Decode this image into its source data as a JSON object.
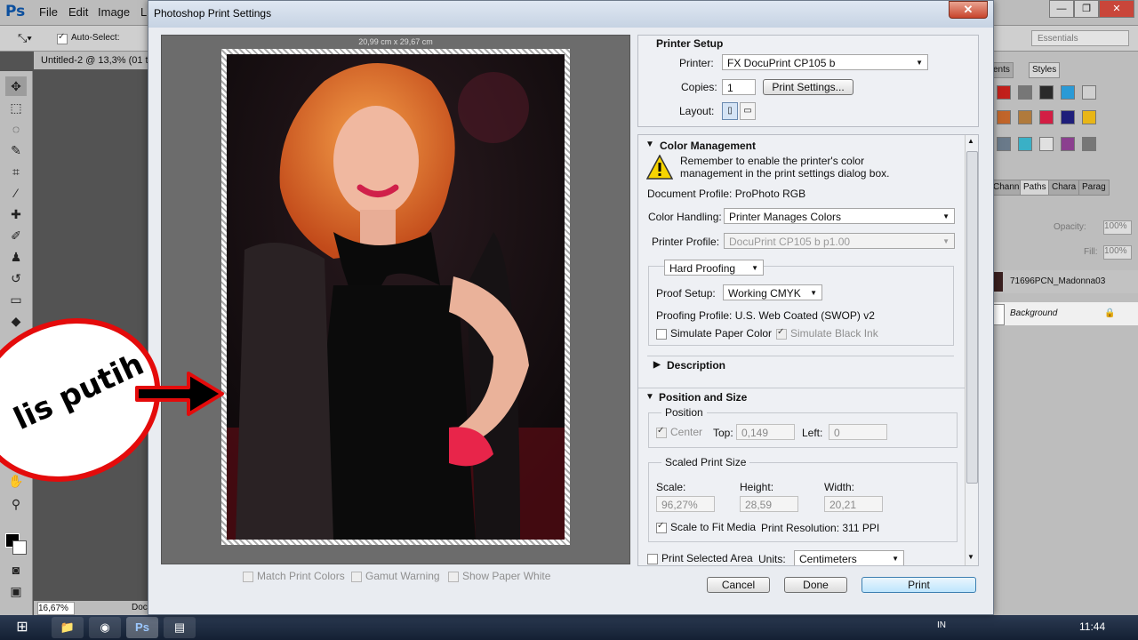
{
  "app": {
    "logo": "Ps",
    "menu": [
      "File",
      "Edit",
      "Image",
      "L"
    ],
    "auto_select_label": "Auto-Select:",
    "essentials": "Essentials",
    "doc_tab": "Untitled-2 @ 13,3% (01 t",
    "zoom": "16,67%",
    "status_doc": "Doc",
    "panel_tabs_top": [
      "ents",
      "Styles"
    ],
    "panel_tabs_mid": [
      "Chann",
      "Paths",
      "Chara",
      "Parag"
    ],
    "opacity_label": "Opacity:",
    "opacity_value": "100%",
    "fill_label": "Fill:",
    "fill_value": "100%",
    "layers": [
      "71696PCN_Madonna03",
      "Background"
    ],
    "taskbar_lang": "IN",
    "clock": "11:44"
  },
  "dialog": {
    "title": "Photoshop Print Settings",
    "close_label": "✕",
    "preview": {
      "dimensions": "20,99 cm x 29,67 cm"
    },
    "preview_options": {
      "match_print_colors": "Match Print Colors",
      "gamut_warning": "Gamut Warning",
      "show_paper_white": "Show Paper White"
    },
    "printer_setup": {
      "heading": "Printer Setup",
      "printer_label": "Printer:",
      "printer_value": "FX DocuPrint CP105 b",
      "copies_label": "Copies:",
      "copies_value": "1",
      "print_settings_button": "Print Settings...",
      "layout_label": "Layout:"
    },
    "color_management": {
      "heading": "Color Management",
      "warning_line1": "Remember to enable the printer's color",
      "warning_line2": "management in the print settings dialog box.",
      "document_profile": "Document Profile: ProPhoto RGB",
      "color_handling_label": "Color Handling:",
      "color_handling_value": "Printer Manages Colors",
      "printer_profile_label": "Printer Profile:",
      "printer_profile_value": "DocuPrint CP105 b p1.00",
      "proofing_mode": "Hard Proofing",
      "proof_setup_label": "Proof Setup:",
      "proof_setup_value": "Working CMYK",
      "proofing_profile": "Proofing Profile: U.S. Web Coated (SWOP) v2",
      "simulate_paper_color": "Simulate Paper Color",
      "simulate_black_ink": "Simulate Black Ink"
    },
    "description": {
      "heading": "Description"
    },
    "position_size": {
      "heading": "Position and Size",
      "position_group": "Position",
      "center_label": "Center",
      "top_label": "Top:",
      "top_value": "0,149",
      "left_label": "Left:",
      "left_value": "0",
      "scaled_group": "Scaled Print Size",
      "scale_label": "Scale:",
      "scale_value": "96,27%",
      "height_label": "Height:",
      "height_value": "28,59",
      "width_label": "Width:",
      "width_value": "20,21",
      "scale_to_fit": "Scale to Fit Media",
      "print_resolution": "Print Resolution: 311 PPI",
      "print_selected_area": "Print Selected Area",
      "units_label": "Units:",
      "units_value": "Centimeters"
    },
    "buttons": {
      "cancel": "Cancel",
      "done": "Done",
      "print": "Print"
    }
  },
  "annotation": {
    "text": "lis putih"
  },
  "colors": {
    "annotation_red": "#e40b0b",
    "dialog_bg": "#e9ecf1",
    "ps_bg": "#535353"
  }
}
